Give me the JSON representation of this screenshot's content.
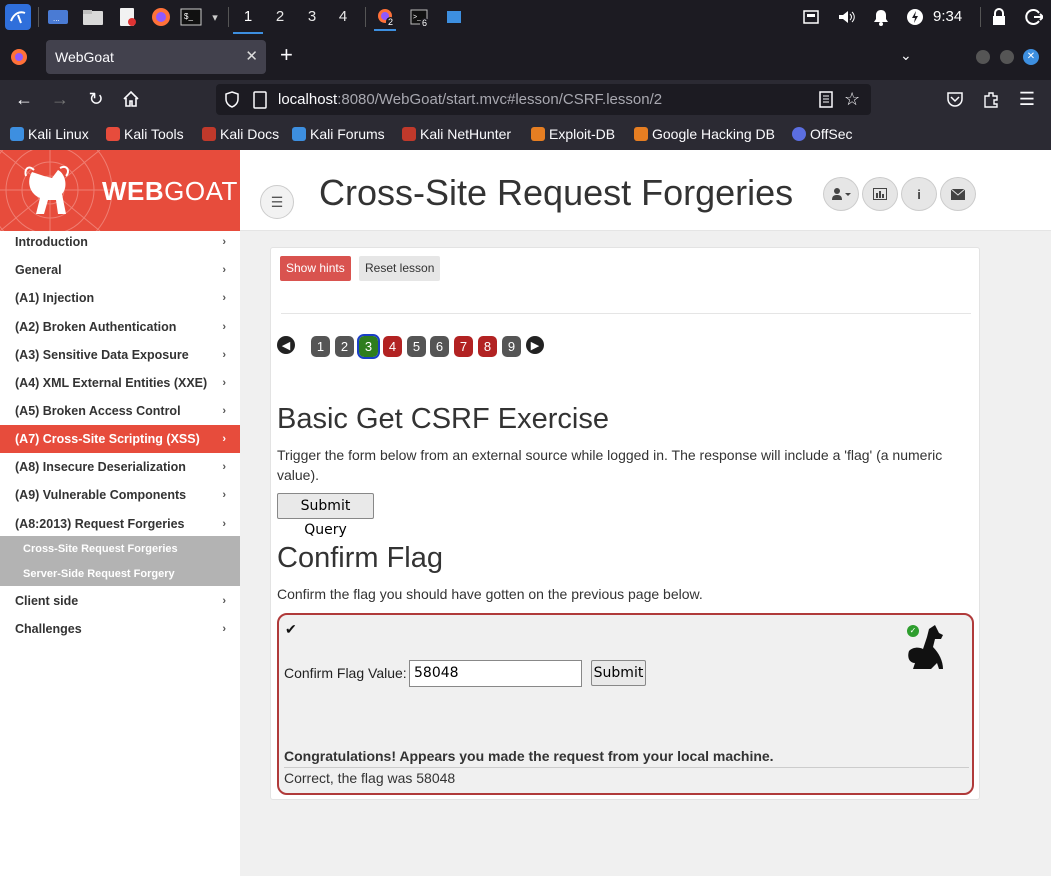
{
  "taskbar": {
    "workspaces": [
      "1",
      "2",
      "3",
      "4"
    ],
    "active_workspace": "1",
    "firefox_badge": "2",
    "terminal_badge": "6",
    "clock": "9:34"
  },
  "browser": {
    "tab_title": "WebGoat",
    "url_host": "localhost",
    "url_rest": ":8080/WebGoat/start.mvc#lesson/CSRF.lesson/2",
    "bookmarks": [
      "Kali Linux",
      "Kali Tools",
      "Kali Docs",
      "Kali Forums",
      "Kali NetHunter",
      "Exploit-DB",
      "Google Hacking DB",
      "OffSec"
    ]
  },
  "brand": {
    "logo_bold": "WEB",
    "logo_rest": "GOAT"
  },
  "header": {
    "title": "Cross-Site Request Forgeries"
  },
  "sidebar": {
    "items": [
      "Introduction",
      "General",
      "(A1) Injection",
      "(A2) Broken Authentication",
      "(A3) Sensitive Data Exposure",
      "(A4) XML External Entities (XXE)",
      "(A5) Broken Access Control",
      "(A7) Cross-Site Scripting (XSS)",
      "(A8) Insecure Deserialization",
      "(A9) Vulnerable Components",
      "(A8:2013) Request Forgeries",
      "Client side",
      "Challenges"
    ],
    "active_item": "(A7) Cross-Site Scripting (XSS)",
    "submenu": [
      "Cross-Site Request Forgeries",
      "Server-Side Request Forgery"
    ]
  },
  "lesson": {
    "show_hints": "Show hints",
    "reset_lesson": "Reset lesson",
    "pages": [
      "1",
      "2",
      "3",
      "4",
      "5",
      "6",
      "7",
      "8",
      "9"
    ],
    "current_page": "3",
    "exercise_title": "Basic Get CSRF Exercise",
    "exercise_text": "Trigger the form below from an external source while logged in. The response will include a 'flag' (a numeric value).",
    "submit_query": "Submit Query",
    "confirm_title": "Confirm Flag",
    "confirm_text": "Confirm the flag you should have gotten on the previous page below.",
    "flag_label": "Confirm Flag Value:",
    "flag_value": "58048",
    "submit": "Submit",
    "success_message": "Congratulations! Appears you made the request from your local machine.",
    "result_message": "Correct, the flag was 58048"
  },
  "colors": {
    "brand_red": "#e74c3c",
    "page_green": "#2e7d1e",
    "page_red": "#b22222",
    "page_grey": "#555555"
  }
}
